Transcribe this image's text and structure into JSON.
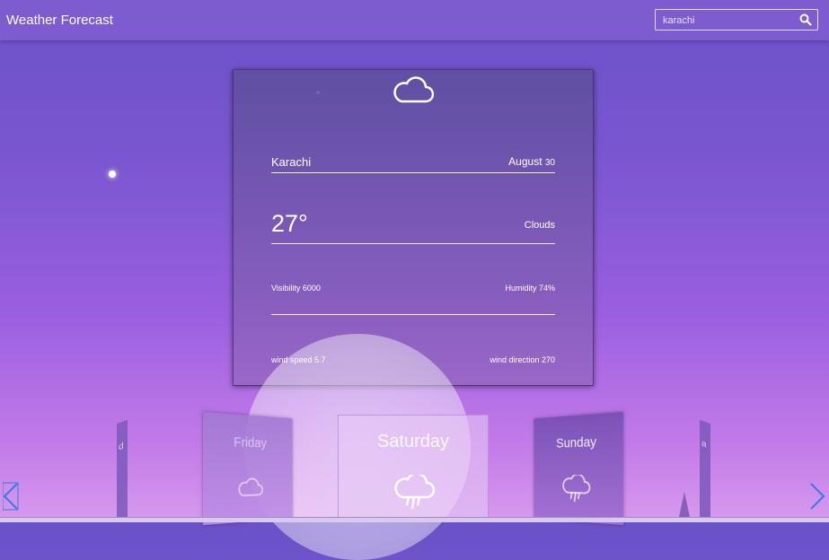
{
  "header": {
    "title": "Weather Forecast",
    "search_value": "karachi"
  },
  "current": {
    "city": "Karachi",
    "month": "August",
    "day": "30",
    "temperature": "27°",
    "condition": "Clouds",
    "visibility": "Visibility 6000",
    "humidity": "Humidity 74%",
    "wind_speed": "wind speed 5.7",
    "wind_direction": "wind direction 270"
  },
  "forecast": {
    "days": [
      "Friday",
      "Saturday",
      "Sunday"
    ],
    "left_edge_glyph": "d",
    "right_edge_glyph": "a"
  },
  "icons": {
    "main": "cloud-icon",
    "friday": "cloud-icon",
    "saturday": "rain-icon",
    "sunday": "rain-icon"
  },
  "colors": {
    "header": "#7c5ccf",
    "accent_arrow": "#3a7ae0"
  }
}
